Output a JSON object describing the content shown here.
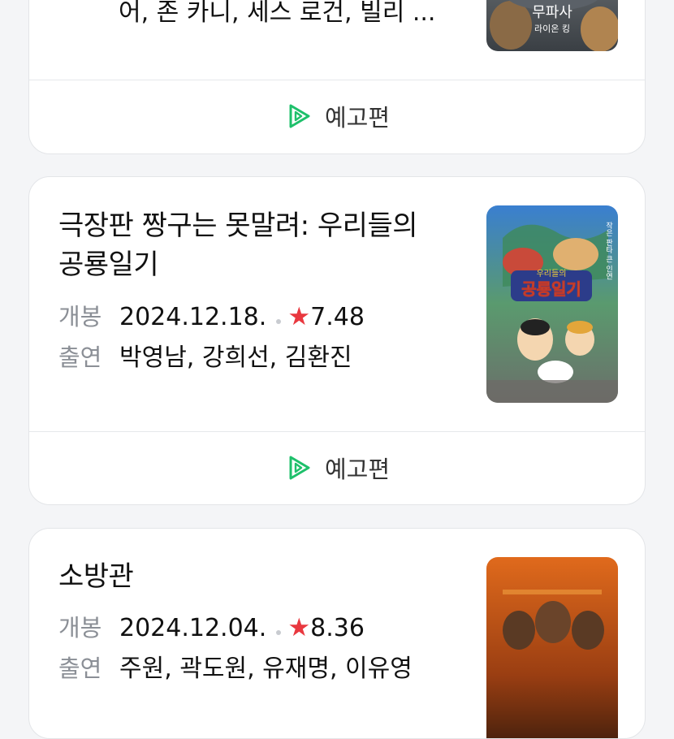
{
  "cards": [
    {
      "cast_partial": "어, 존 카니, 세스 로건, 빌리 ...",
      "poster": {
        "title": "무파사",
        "subtitle": "라이온 킹"
      },
      "trailer_label": "예고편"
    },
    {
      "title": "극장판 짱구는 못말려: 우리들의 공룡일기",
      "release_label": "개봉",
      "release_date": "2024.12.18.",
      "rating_star": "★",
      "rating": "7.48",
      "cast_label": "출연",
      "cast": "박영남, 강희선, 김환진",
      "poster": {
        "title": "공룡일기",
        "top_text": "우리들의",
        "side_text": "작은 판타 큰 인연"
      },
      "trailer_label": "예고편"
    },
    {
      "title": "소방관",
      "release_label": "개봉",
      "release_date": "2024.12.04.",
      "rating_star": "★",
      "rating": "8.36",
      "cast_label": "출연",
      "cast": "주원, 곽도원, 유재명, 이유영"
    }
  ],
  "colors": {
    "accent_green": "#1ec06b",
    "star_red": "#e9383f"
  },
  "icons": {
    "trailer": "play-triangle-icon"
  }
}
